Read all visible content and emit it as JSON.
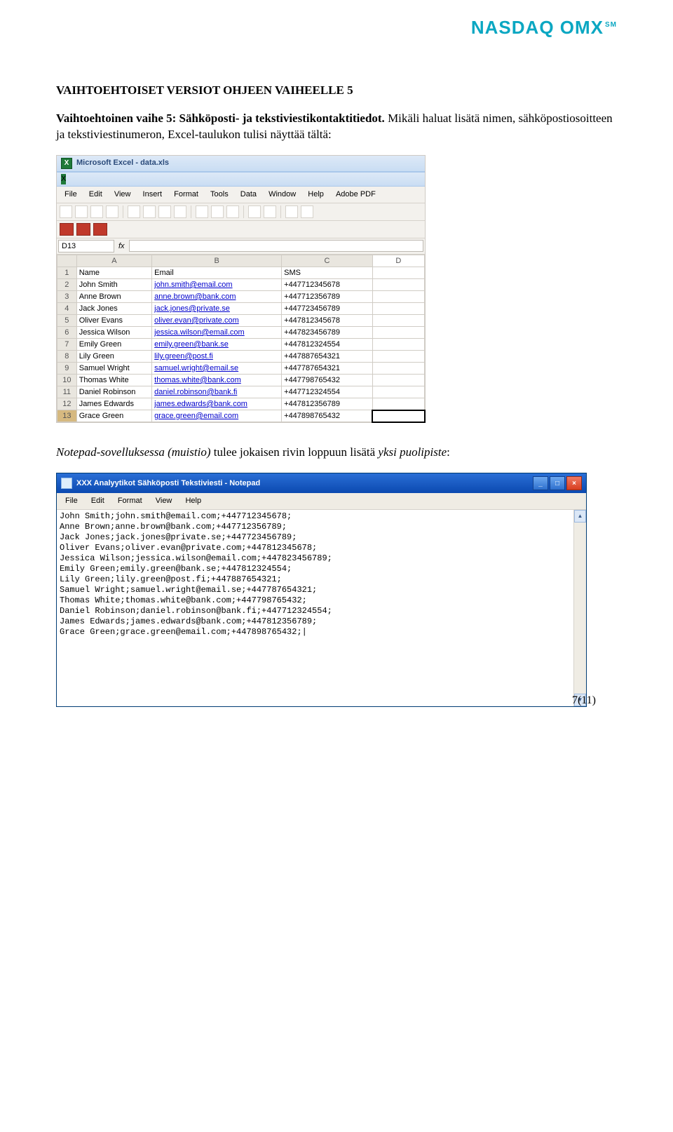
{
  "logo_text": "NASDAQ OMX",
  "logo_sm": "SM",
  "heading": "VAIHTOEHTOISET VERSIOT OHJEEN VAIHEELLE 5",
  "para1_strong": "Vaihtoehtoinen vaihe 5: Sähköposti- ja tekstiviestikontaktitiedot.",
  "para1_rest": " Mikäli haluat lisätä nimen, sähköpostiosoitteen ja tekstiviestinumeron, Excel-taulukon tulisi näyttää tältä:",
  "para2_a": "Notepad-sovelluksessa (muistio)",
  "para2_b": " tulee jokaisen rivin loppuun lisätä ",
  "para2_c": "yksi puolipiste",
  "para2_d": ":",
  "pagenum": "7(11)",
  "excel": {
    "app_title": "Microsoft Excel - data.xls",
    "menu": [
      "File",
      "Edit",
      "View",
      "Insert",
      "Format",
      "Tools",
      "Data",
      "Window",
      "Help",
      "Adobe PDF"
    ],
    "cellref": "D13",
    "fx": "fx",
    "cols": [
      "",
      "A",
      "B",
      "C",
      "D"
    ],
    "rows": [
      {
        "n": "1",
        "a": "Name",
        "b": "Email",
        "c": "SMS",
        "email": false
      },
      {
        "n": "2",
        "a": "John Smith",
        "b": "john.smith@email.com",
        "c": "+447712345678",
        "email": true
      },
      {
        "n": "3",
        "a": "Anne Brown",
        "b": "anne.brown@bank.com",
        "c": "+447712356789",
        "email": true
      },
      {
        "n": "4",
        "a": "Jack Jones",
        "b": "jack.jones@private.se",
        "c": "+447723456789",
        "email": true
      },
      {
        "n": "5",
        "a": "Oliver Evans",
        "b": "oliver.evan@private.com",
        "c": "+447812345678",
        "email": true
      },
      {
        "n": "6",
        "a": "Jessica Wilson",
        "b": "jessica.wilson@email.com",
        "c": "+447823456789",
        "email": true
      },
      {
        "n": "7",
        "a": "Emily Green",
        "b": "emily.green@bank.se",
        "c": "+447812324554",
        "email": true
      },
      {
        "n": "8",
        "a": "Lily Green",
        "b": "lily.green@post.fi",
        "c": "+447887654321",
        "email": true
      },
      {
        "n": "9",
        "a": "Samuel Wright",
        "b": "samuel.wright@email.se",
        "c": "+447787654321",
        "email": true
      },
      {
        "n": "10",
        "a": "Thomas White",
        "b": "thomas.white@bank.com",
        "c": "+447798765432",
        "email": true
      },
      {
        "n": "11",
        "a": "Daniel Robinson",
        "b": "daniel.robinson@bank.fi",
        "c": "+447712324554",
        "email": true
      },
      {
        "n": "12",
        "a": "James Edwards",
        "b": "james.edwards@bank.com",
        "c": "+447812356789",
        "email": true
      },
      {
        "n": "13",
        "a": "Grace Green",
        "b": "grace.green@email.com",
        "c": "+447898765432",
        "email": true
      }
    ]
  },
  "notepad": {
    "title": "XXX Analyytikot Sähköposti Tekstiviesti - Notepad",
    "menu": [
      "File",
      "Edit",
      "Format",
      "View",
      "Help"
    ],
    "lines": [
      "John Smith;john.smith@email.com;+447712345678;",
      "Anne Brown;anne.brown@bank.com;+447712356789;",
      "Jack Jones;jack.jones@private.se;+447723456789;",
      "Oliver Evans;oliver.evan@private.com;+447812345678;",
      "Jessica Wilson;jessica.wilson@email.com;+447823456789;",
      "Emily Green;emily.green@bank.se;+447812324554;",
      "Lily Green;lily.green@post.fi;+447887654321;",
      "Samuel Wright;samuel.wright@email.se;+447787654321;",
      "Thomas White;thomas.white@bank.com;+447798765432;",
      "Daniel Robinson;daniel.robinson@bank.fi;+447712324554;",
      "James Edwards;james.edwards@bank.com;+447812356789;",
      "Grace Green;grace.green@email.com;+447898765432;|"
    ]
  }
}
